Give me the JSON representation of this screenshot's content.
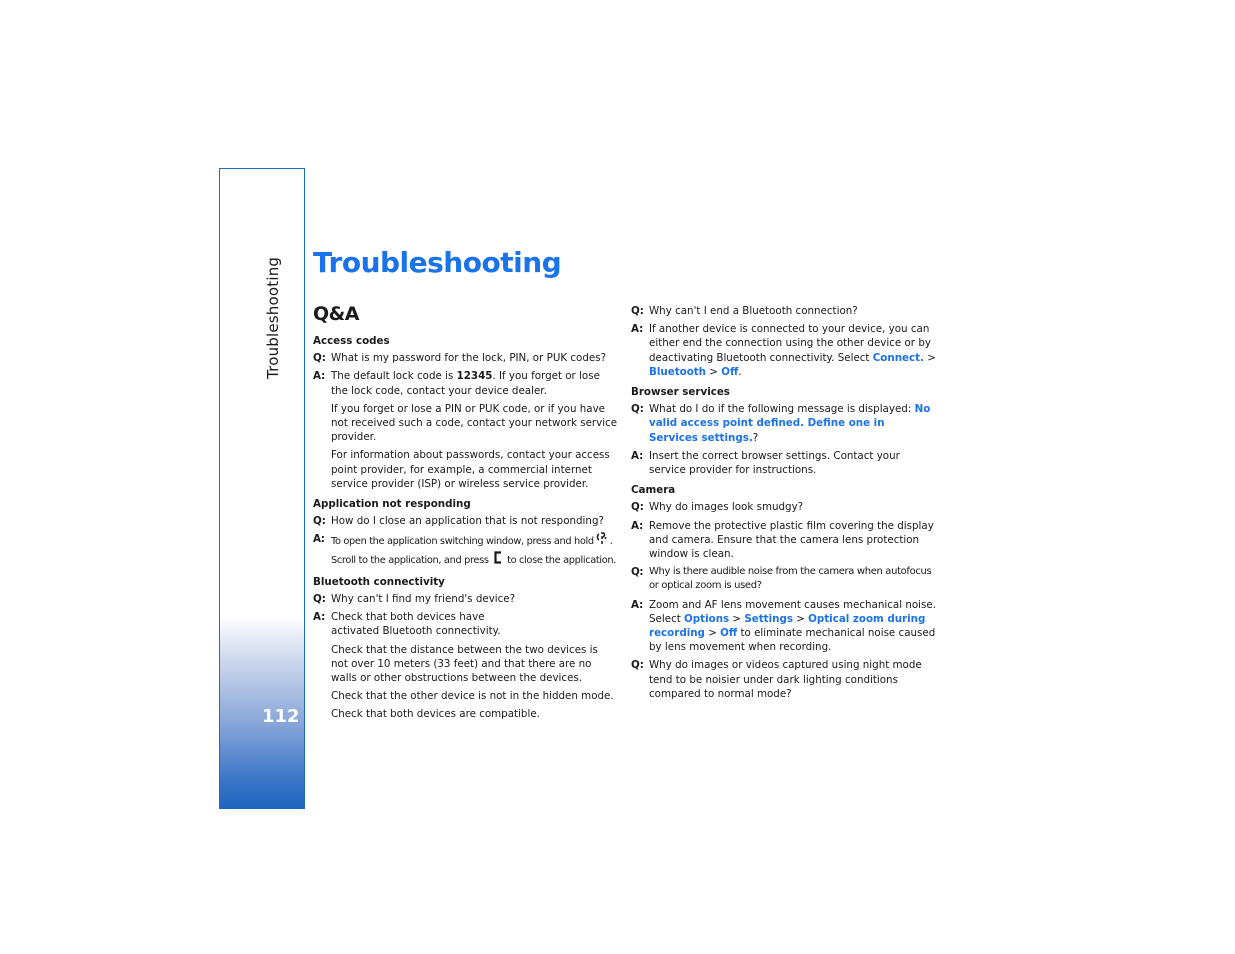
{
  "sidebar": {
    "chapter_label": "Troubleshooting",
    "page_number": "112"
  },
  "page": {
    "title": "Troubleshooting",
    "subtitle": "Q&A"
  },
  "sections": {
    "access_codes": {
      "heading": "Access codes",
      "q_mark": "Q:",
      "a_mark": "A:",
      "question": "What is my password for the lock, PIN, or PUK codes?",
      "answer_1_pre": "The default lock code is ",
      "answer_1_code": "12345",
      "answer_1_post": ". If you forget or lose the lock code, contact your device dealer.",
      "answer_2": "If you forget or lose a PIN or PUK code, or if you have not received such a code, contact your network service provider.",
      "answer_3": "For information about passwords, contact your access point provider, for example, a commercial internet service provider (ISP) or wireless service provider."
    },
    "app_not_responding": {
      "heading": "Application not responding",
      "q_mark": "Q:",
      "a_mark": "A:",
      "question": "How do I close an application that is not responding?",
      "answer_pre": "To open the application switching window, press and hold",
      "answer_icon_1": "menu-key-icon",
      "answer_mid": ". Scroll to the application, and press",
      "answer_icon_2": "clear-key-icon",
      "answer_post": "to close the application."
    },
    "bluetooth": {
      "heading": "Bluetooth connectivity",
      "q_mark": "Q:",
      "a_mark": "A:",
      "question_1": "Why can't I find my friend's device?",
      "answer_1a": "Check that both devices have activated Bluetooth connectivity.",
      "answer_1b": "Check that the distance between the two devices is not over 10 meters (33 feet) and that there are no walls or other obstructions between the devices.",
      "answer_1c": "Check that the other device is not in the hidden mode.",
      "answer_1d": "Check that both devices are compatible.",
      "question_2": "Why can't I end a Bluetooth connection?",
      "answer_2_pre": "If another device is connected to your device, you can either end the connection using the other device or by deactivating Bluetooth connectivity. Select ",
      "answer_2_link_1": "Connect.",
      "answer_2_sep_1": " > ",
      "answer_2_link_2": "Bluetooth",
      "answer_2_sep_2": " > ",
      "answer_2_link_3": "Off",
      "answer_2_post": "."
    },
    "browser": {
      "heading": "Browser services",
      "q_mark": "Q:",
      "a_mark": "A:",
      "question_pre": "What do I do if the following message is displayed: ",
      "question_link": "No valid access point defined. Define one in Services settings.",
      "question_post": "?",
      "answer": "Insert the correct browser settings. Contact your service provider for instructions."
    },
    "camera": {
      "heading": "Camera",
      "q_mark": "Q:",
      "a_mark": "A:",
      "question_1": "Why do images look smudgy?",
      "answer_1": "Remove the protective plastic film covering the display and camera. Ensure that the camera lens protection window is clean.",
      "question_2": "Why is there audible noise from the camera when autofocus or optical zoom is used?",
      "answer_2_pre": "Zoom and AF lens movement causes mechanical noise. Select ",
      "answer_2_link_1": "Options",
      "answer_2_sep_1": " > ",
      "answer_2_link_2": "Settings",
      "answer_2_sep_2": " > ",
      "answer_2_link_3": "Optical zoom during recording",
      "answer_2_sep_3": " > ",
      "answer_2_link_4": "Off",
      "answer_2_post": " to eliminate mechanical noise caused by lens movement when recording.",
      "question_3": "Why do images or videos captured using night mode tend to be noisier under dark lighting conditions compared to normal mode?"
    }
  },
  "colors": {
    "accent": "#1a73e8",
    "sidebar_border": "#1f6cc4",
    "sidebar_gradient_bottom": "#1d63bf"
  }
}
